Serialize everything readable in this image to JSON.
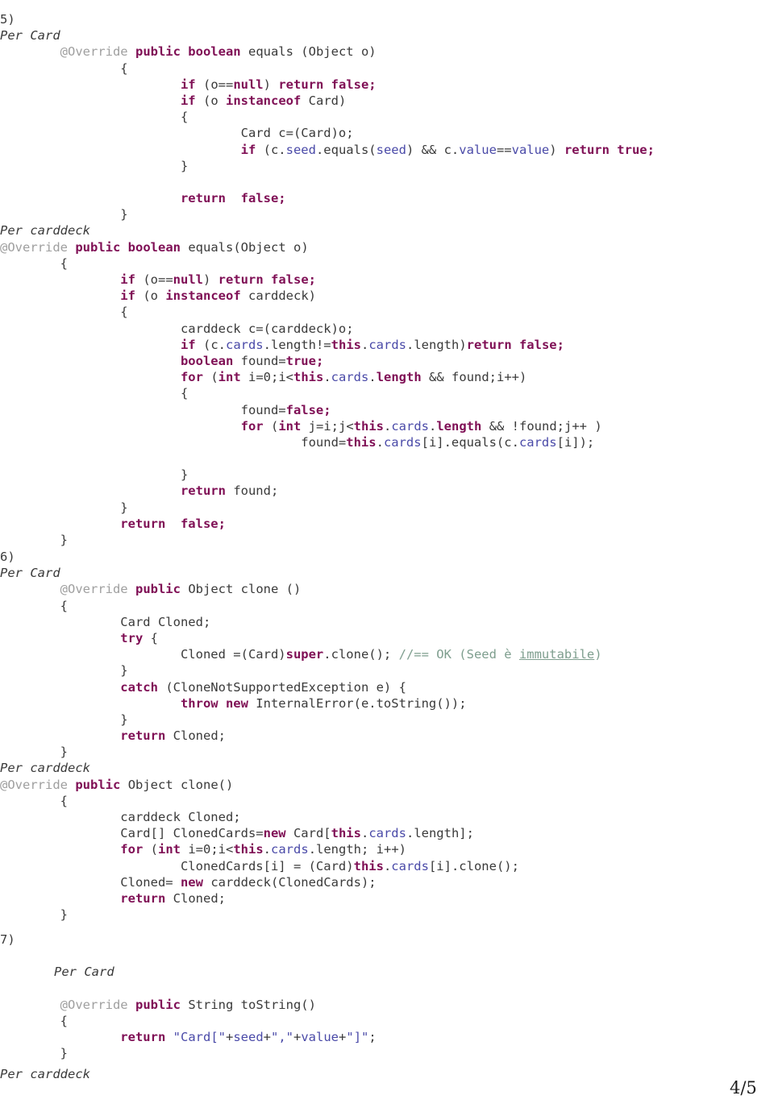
{
  "document": {
    "page_number": "4/5",
    "footer_label": "Per carddeck"
  },
  "sections": [
    {
      "marker": "5)",
      "caption": "Per Card"
    },
    {
      "caption2": "Per carddeck"
    },
    {
      "marker": "6)",
      "caption": "Per Card"
    },
    {
      "caption2": "Per carddeck"
    },
    {
      "marker": "7)",
      "caption": "Per Card"
    }
  ],
  "labels": {
    "marker_5": "5)",
    "marker_6": "6)",
    "marker_7": "7)",
    "per_card_1": "Per Card",
    "per_carddeck_1": "Per carddeck",
    "per_card_2": "Per Card",
    "per_carddeck_2": "Per carddeck",
    "per_card_3": "Per Card"
  },
  "code": {
    "card_equals": [
      "        @Override public boolean equals (Object o)",
      "                {",
      "                        if (o==null) return false;",
      "                        if (o instanceof Card)",
      "                        {",
      "                                Card c=(Card)o;",
      "                                if (c.seed.equals(seed) && c.value==value) return true;",
      "                        }",
      "",
      "                        return  false;",
      "                }"
    ],
    "carddeck_equals": [
      "@Override public boolean equals(Object o)",
      "        {",
      "                if (o==null) return false;",
      "                if (o instanceof carddeck)",
      "                {",
      "                        carddeck c=(carddeck)o;",
      "                        if (c.cards.length!=this.cards.length)return false;",
      "                        boolean found=true;",
      "                        for (int i=0;i<this.cards.length && found;i++)",
      "                        {",
      "                                found=false;",
      "                                for (int j=i;j<this.cards.length && !found;j++ )",
      "                                        found=this.cards[i].equals(c.cards[i]);",
      "",
      "                        }",
      "                        return found;",
      "                }",
      "                return  false;",
      "        }"
    ],
    "card_clone": [
      "        @Override public Object clone ()",
      "        {",
      "                Card Cloned;",
      "                try {",
      "                        Cloned =(Card)super.clone(); //== OK (Seed è immutabile)",
      "                }",
      "                catch (CloneNotSupportedException e) {",
      "                        throw new InternalError(e.toString());",
      "                }",
      "                return Cloned;",
      "        }"
    ],
    "carddeck_clone": [
      "@Override public Object clone()",
      "        {",
      "                carddeck Cloned;",
      "                Card[] ClonedCards=new Card[this.cards.length];",
      "                for (int i=0;i<this.cards.length; i++)",
      "                        ClonedCards[i] = (Card)this.cards[i].clone();",
      "                Cloned= new carddeck(ClonedCards);",
      "                return Cloned;",
      "        }"
    ],
    "card_tostring": [
      "        @Override public String toString()",
      "        {",
      "                return \"Card[\"+seed+\",\"+value+\"]\";",
      "        }"
    ]
  }
}
